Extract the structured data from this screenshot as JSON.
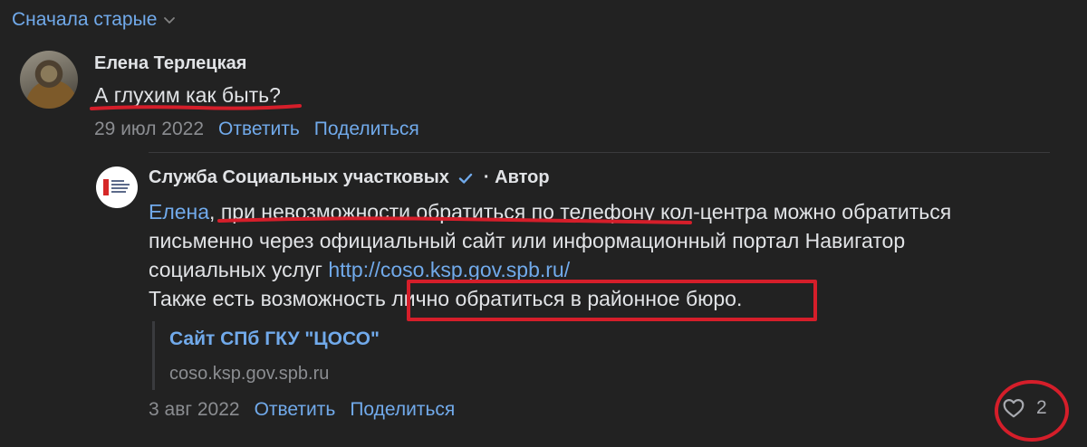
{
  "sort": {
    "label": "Сначала старые",
    "icon": "chevron-down-icon"
  },
  "comment": {
    "author": "Елена Терлецкая",
    "text": "А глухим как быть?",
    "date": "29 июл 2022",
    "reply_label": "Ответить",
    "share_label": "Поделиться"
  },
  "reply": {
    "author": "Служба Социальных участковых",
    "verified_icon": "verified-check-icon",
    "author_badge": "· Автор",
    "mention": "Елена",
    "line1_a": ", ",
    "line1_b": "при невозможности обратиться по телефону",
    "line1_c": " кол-центра можно обратиться",
    "line2": "письменно через официальный сайт или информационный портал Навигатор",
    "line3_a": "социальных услуг ",
    "line3_link": "http://coso.ksp.gov.spb.ru/",
    "line4_a": "Также есть возможность ",
    "line4_b": "лично обратиться в районное бюро.",
    "snippet_title": "Сайт СПб ГКУ \"ЦОСО\"",
    "snippet_domain": "coso.ksp.gov.spb.ru",
    "date": "3 авг 2022",
    "reply_label": "Ответить",
    "share_label": "Поделиться",
    "likes": "2",
    "like_icon": "heart-icon"
  },
  "annotation_color": "#d51e2a",
  "link_color": "#71aaeb"
}
